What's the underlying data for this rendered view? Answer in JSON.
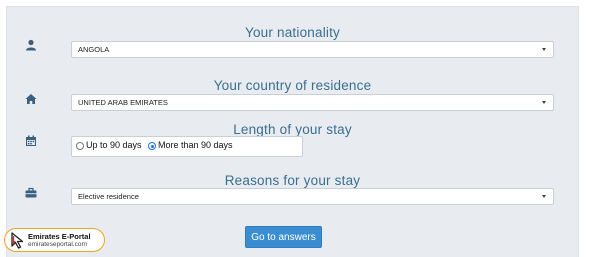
{
  "nationality": {
    "title": "Your nationality",
    "selected": "ANGOLA",
    "icon": "user-icon"
  },
  "residence": {
    "title": "Your country of residence",
    "selected": "UNITED ARAB EMIRATES",
    "icon": "home-icon"
  },
  "stay": {
    "title": "Length of your stay",
    "icon": "calendar-icon",
    "options": [
      {
        "label": "Up to 90 days",
        "checked": false
      },
      {
        "label": "More than 90 days",
        "checked": true
      }
    ]
  },
  "reasons": {
    "title": "Reasons for your stay",
    "selected": "Elective residence",
    "icon": "briefcase-icon"
  },
  "submit_label": "Go to answers",
  "logo": {
    "name": "Emirates E-Portal",
    "url": "emirateseportal.com",
    "accent": "#f0a21b"
  },
  "colors": {
    "title": "#3a6f8f",
    "button": "#3b8dd1",
    "panel": "#e8ebf0"
  }
}
